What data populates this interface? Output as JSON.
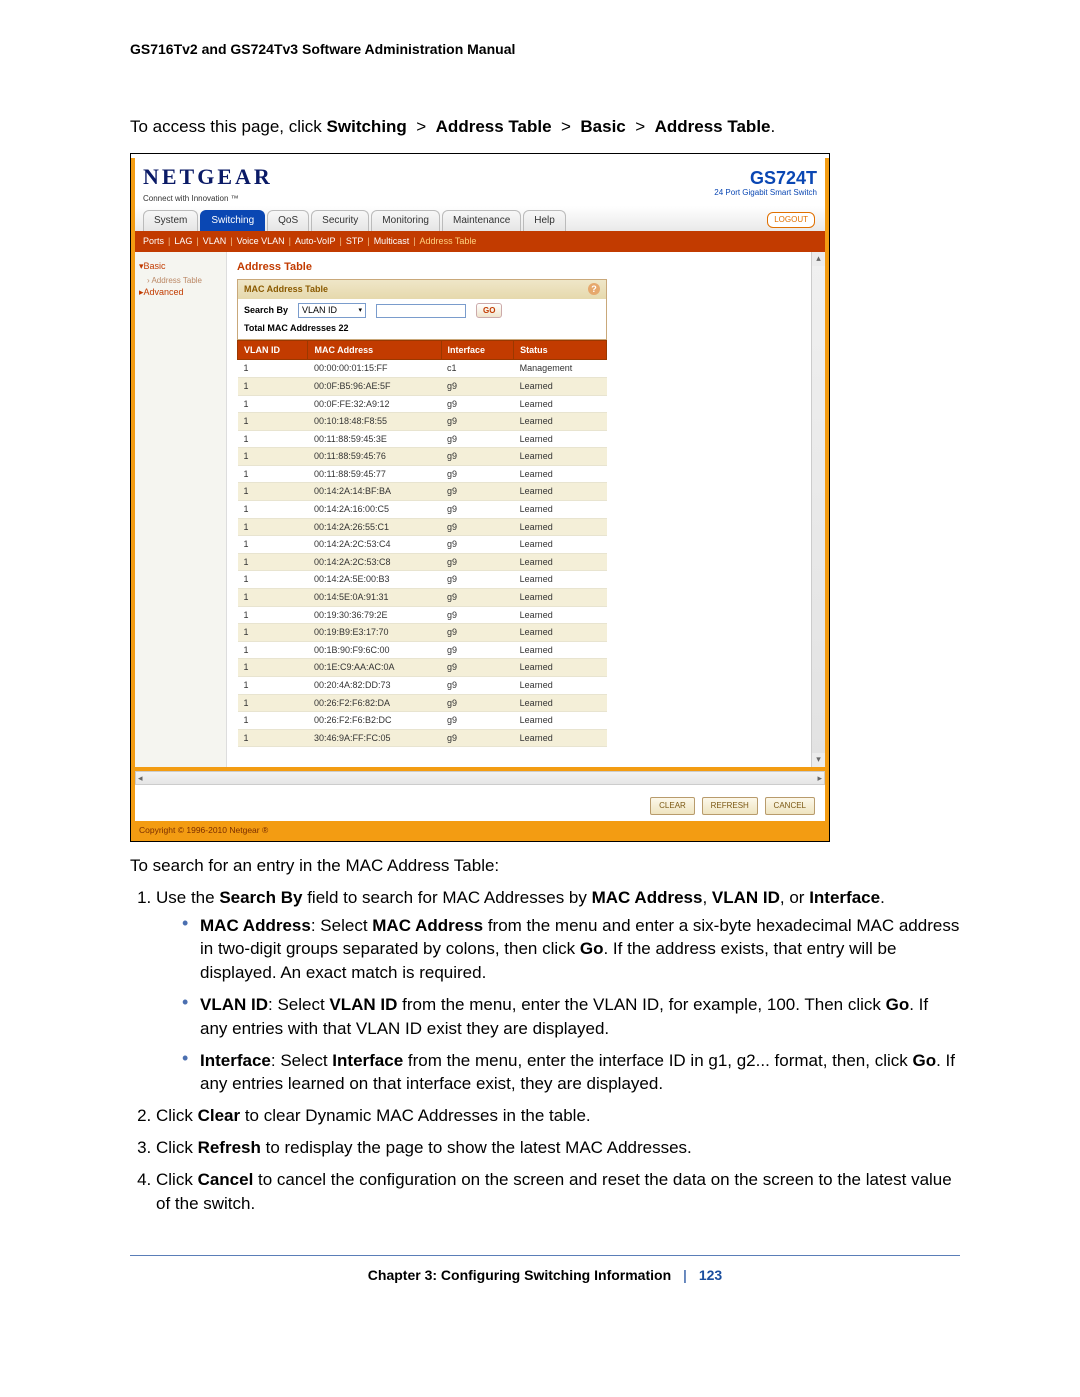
{
  "manual_header": "GS716Tv2 and GS724Tv3 Software Administration Manual",
  "intro": {
    "prefix": "To access this page, click ",
    "path": [
      "Switching",
      "Address Table",
      "Basic",
      "Address Table"
    ],
    "suffix": "."
  },
  "ui": {
    "brand": {
      "name": "NETGEAR",
      "tagline": "Connect with Innovation ™",
      "model": "GS724T",
      "model_desc": "24 Port Gigabit Smart Switch"
    },
    "tabs": [
      "System",
      "Switching",
      "QoS",
      "Security",
      "Monitoring",
      "Maintenance",
      "Help"
    ],
    "active_tab_index": 1,
    "logout_label": "LOGOUT",
    "subnav": [
      "Ports",
      "LAG",
      "VLAN",
      "Voice VLAN",
      "Auto-VoIP",
      "STP",
      "Multicast",
      "Address Table"
    ],
    "subnav_active_index": 7,
    "sidebar": {
      "items": [
        {
          "label": "Basic",
          "open": true,
          "children": [
            "Address Table"
          ]
        },
        {
          "label": "Advanced",
          "open": false,
          "children": []
        }
      ]
    },
    "content": {
      "title": "Address Table",
      "box_title": "MAC Address Table",
      "search_label": "Search By",
      "search_select_value": "VLAN ID",
      "go_label": "GO",
      "total_label_prefix": "Total MAC Addresses ",
      "total_count": "22",
      "columns": [
        "VLAN ID",
        "MAC Address",
        "Interface",
        "Status"
      ],
      "rows": [
        {
          "vlan": "1",
          "mac": "00:00:00:01:15:FF",
          "iface": "c1",
          "status": "Management"
        },
        {
          "vlan": "1",
          "mac": "00:0F:B5:96:AE:5F",
          "iface": "g9",
          "status": "Learned"
        },
        {
          "vlan": "1",
          "mac": "00:0F:FE:32:A9:12",
          "iface": "g9",
          "status": "Learned"
        },
        {
          "vlan": "1",
          "mac": "00:10:18:48:F8:55",
          "iface": "g9",
          "status": "Learned"
        },
        {
          "vlan": "1",
          "mac": "00:11:88:59:45:3E",
          "iface": "g9",
          "status": "Learned"
        },
        {
          "vlan": "1",
          "mac": "00:11:88:59:45:76",
          "iface": "g9",
          "status": "Learned"
        },
        {
          "vlan": "1",
          "mac": "00:11:88:59:45:77",
          "iface": "g9",
          "status": "Learned"
        },
        {
          "vlan": "1",
          "mac": "00:14:2A:14:BF:BA",
          "iface": "g9",
          "status": "Learned"
        },
        {
          "vlan": "1",
          "mac": "00:14:2A:16:00:C5",
          "iface": "g9",
          "status": "Learned"
        },
        {
          "vlan": "1",
          "mac": "00:14:2A:26:55:C1",
          "iface": "g9",
          "status": "Learned"
        },
        {
          "vlan": "1",
          "mac": "00:14:2A:2C:53:C4",
          "iface": "g9",
          "status": "Learned"
        },
        {
          "vlan": "1",
          "mac": "00:14:2A:2C:53:C8",
          "iface": "g9",
          "status": "Learned"
        },
        {
          "vlan": "1",
          "mac": "00:14:2A:5E:00:B3",
          "iface": "g9",
          "status": "Learned"
        },
        {
          "vlan": "1",
          "mac": "00:14:5E:0A:91:31",
          "iface": "g9",
          "status": "Learned"
        },
        {
          "vlan": "1",
          "mac": "00:19:30:36:79:2E",
          "iface": "g9",
          "status": "Learned"
        },
        {
          "vlan": "1",
          "mac": "00:19:B9:E3:17:70",
          "iface": "g9",
          "status": "Learned"
        },
        {
          "vlan": "1",
          "mac": "00:1B:90:F9:6C:00",
          "iface": "g9",
          "status": "Learned"
        },
        {
          "vlan": "1",
          "mac": "00:1E:C9:AA:AC:0A",
          "iface": "g9",
          "status": "Learned"
        },
        {
          "vlan": "1",
          "mac": "00:20:4A:82:DD:73",
          "iface": "g9",
          "status": "Learned"
        },
        {
          "vlan": "1",
          "mac": "00:26:F2:F6:82:DA",
          "iface": "g9",
          "status": "Learned"
        },
        {
          "vlan": "1",
          "mac": "00:26:F2:F6:B2:DC",
          "iface": "g9",
          "status": "Learned"
        },
        {
          "vlan": "1",
          "mac": "30:46:9A:FF:FC:05",
          "iface": "g9",
          "status": "Learned"
        }
      ]
    },
    "footer_buttons": [
      "CLEAR",
      "REFRESH",
      "CANCEL"
    ],
    "copyright": "Copyright © 1996-2010 Netgear ®"
  },
  "body": {
    "after_img": "To search for an entry in the MAC Address Table:",
    "step1_pre": "Use the ",
    "step1_b1": "Search By",
    "step1_mid": " field to search for MAC Addresses by ",
    "step1_b2": "MAC Address",
    "step1_b3": "VLAN ID",
    "step1_b4": "Interface",
    "bullet_mac_b1": "MAC Address",
    "bullet_mac_b2": "MAC Address",
    "bullet_mac_b3": "Go",
    "bullet_mac_text_a": ": Select ",
    "bullet_mac_text_b": " from the menu and enter a six-byte hexadecimal MAC address in two-digit groups separated by colons, then click ",
    "bullet_mac_text_c": ". If the address exists, that entry will be displayed. An exact match is required.",
    "bullet_vlan_b1": "VLAN ID",
    "bullet_vlan_b2": "VLAN ID",
    "bullet_vlan_b3": "Go",
    "bullet_vlan_text_a": ": Select ",
    "bullet_vlan_text_b": " from the menu, enter the VLAN ID, for example, 100. Then click ",
    "bullet_vlan_text_c": ". If any entries with that VLAN ID exist they are displayed.",
    "bullet_if_b1": "Interface",
    "bullet_if_b2": "Interface",
    "bullet_if_b3": "Go",
    "bullet_if_text_a": ": Select ",
    "bullet_if_text_b": " from the menu, enter the interface ID in g1, g2... format, then, click ",
    "bullet_if_text_c": ". If any entries learned on that interface exist, they are displayed.",
    "step2_pre": "Click ",
    "step2_b": "Clear",
    "step2_post": " to clear Dynamic MAC Addresses in the table.",
    "step3_pre": "Click ",
    "step3_b": "Refresh",
    "step3_post": " to redisplay the page to show the latest MAC Addresses.",
    "step4_pre": "Click ",
    "step4_b": "Cancel",
    "step4_post": " to cancel the configuration on the screen and reset the data on the screen to the latest value of the switch."
  },
  "footer": {
    "chapter": "Chapter 3:  Configuring Switching Information",
    "page": "123"
  }
}
